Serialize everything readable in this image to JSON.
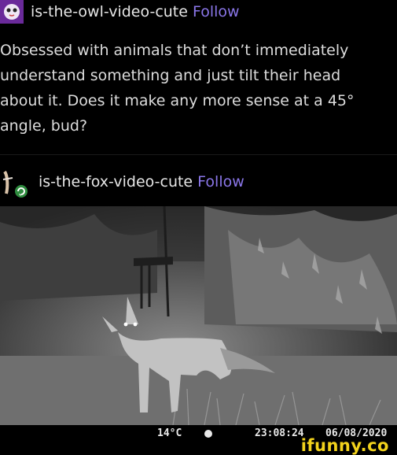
{
  "post1": {
    "username": "is-the-owl-video-cute",
    "follow_label": "Follow",
    "body": "Obsessed with animals that don’t immediately understand something and just tilt their head about it. Does it make any more sense at a 45° angle, bud?"
  },
  "post2": {
    "username": "is-the-fox-video-cute",
    "follow_label": "Follow"
  },
  "camera": {
    "temperature": "14°C",
    "time": "23:08:24",
    "date": "06/08/2020"
  },
  "footer": {
    "watermark": "ifunny.co"
  },
  "colors": {
    "background": "#000000",
    "text": "#dcdcdc",
    "follow": "#8a76e8",
    "watermark": "#f2d21c"
  }
}
